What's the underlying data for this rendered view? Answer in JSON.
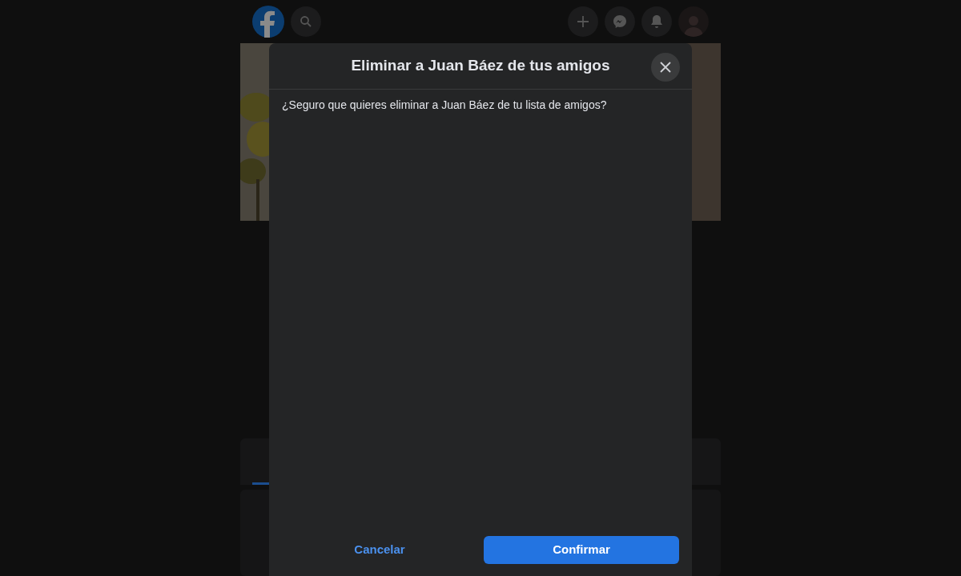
{
  "dialog": {
    "title": "Eliminar a Juan Báez de tus amigos",
    "message": "¿Seguro que quieres eliminar a Juan Báez de tu lista de amigos?",
    "buttons": [
      {
        "label": "Cancelar",
        "kind": "secondary"
      },
      {
        "label": "Confirmar",
        "kind": "primary"
      }
    ]
  }
}
